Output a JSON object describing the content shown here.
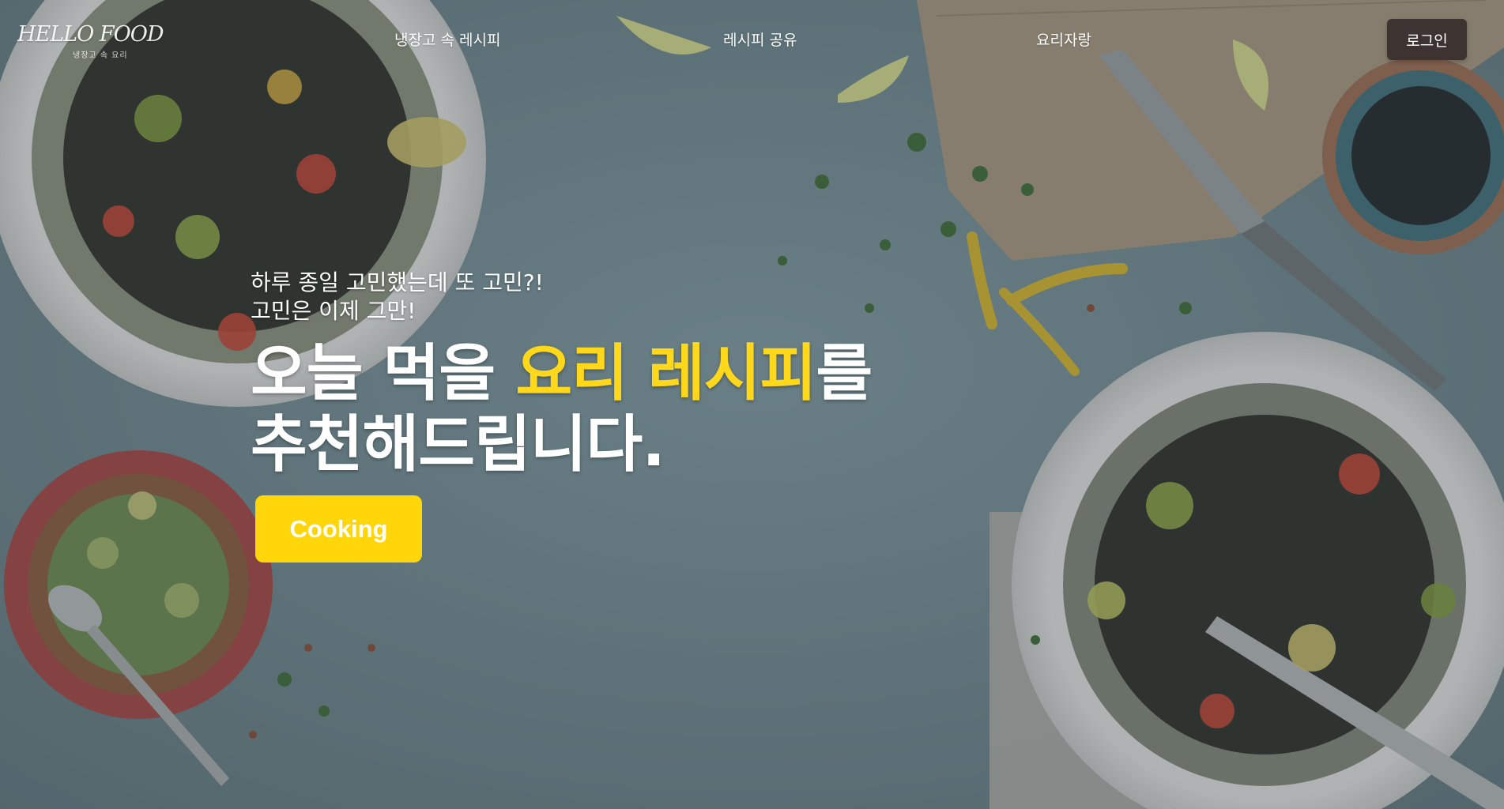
{
  "header": {
    "logo": {
      "text": "HELLO FOOD",
      "subtext": "냉장고 속 요리"
    },
    "nav": [
      {
        "label": "냉장고 속 레시피"
      },
      {
        "label": "레시피 공유"
      },
      {
        "label": "요리자랑"
      }
    ],
    "login_label": "로그인"
  },
  "hero": {
    "subtitle_line1": "하루 종일 고민했는데 또 고민?!",
    "subtitle_line2": "고민은 이제 그만!",
    "title_part1": "오늘 먹을 ",
    "title_highlight": "요리 레시피",
    "title_part2": "를",
    "title_line2": "추천해드립니다.",
    "cta_label": "Cooking"
  },
  "colors": {
    "accent": "#ffd81c",
    "button": "#ffd60a",
    "login_button": "#3d3331",
    "background": "#5f7278"
  },
  "icons": []
}
